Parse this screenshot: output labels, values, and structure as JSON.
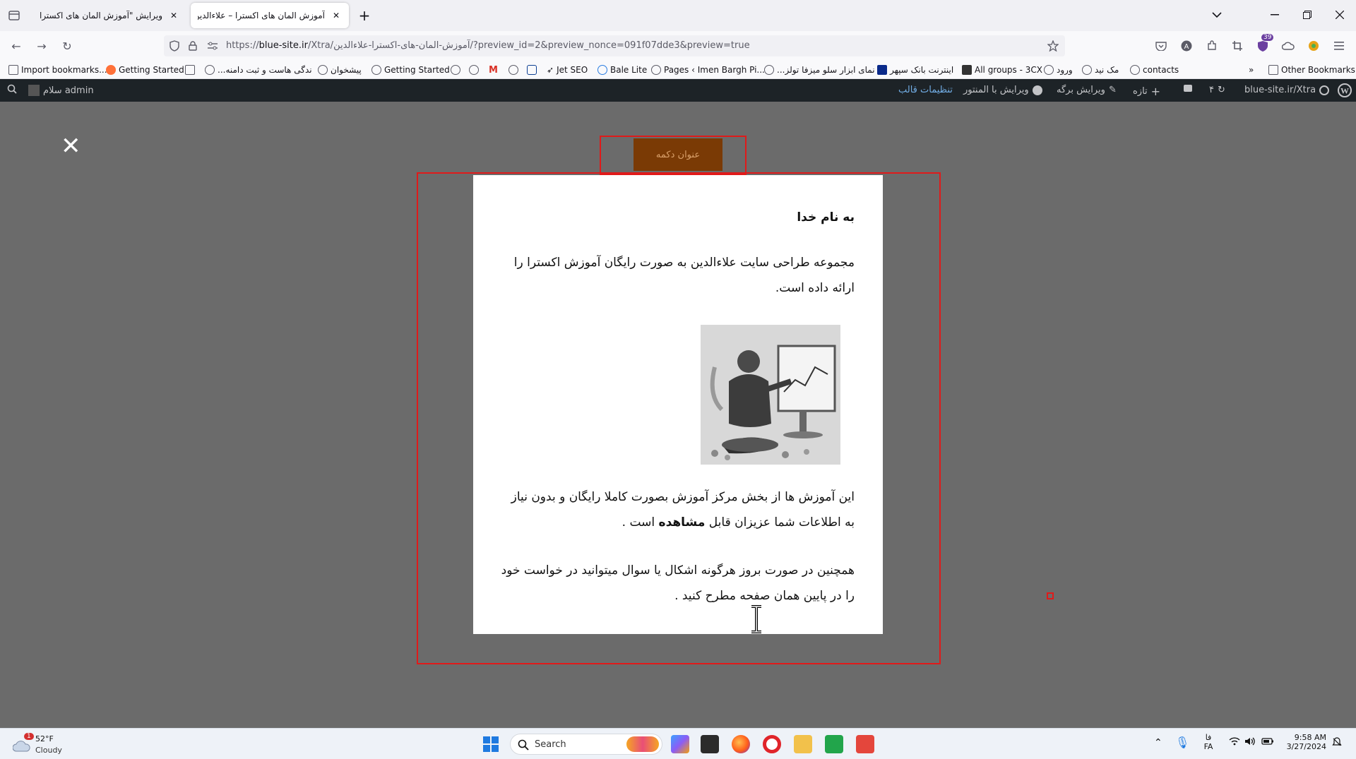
{
  "browser": {
    "tabs": [
      {
        "title": "ویرایش \"آموزش المان های اکسترا – علا",
        "active": false
      },
      {
        "title": "آموزش المان های اکسترا – علاءالدین",
        "active": true
      }
    ],
    "url_prefix": "https://",
    "url_domain": "blue-site.ir",
    "url_rest": "/Xtra/آموزش-المان-های-اکسترا-علاءالدین/?preview_id=2&preview_nonce=091f07dde3&preview=true",
    "notification_badge": "39",
    "bookmarks": [
      "Import bookmarks...",
      "Getting Started",
      "...ندگی هاست و ثبت دامنه",
      "پیشخوان",
      "Getting Started",
      "Jet SEO",
      "Bale Lite",
      "Pages ‹ Imen Bargh Pi...",
      "...نمای ابزار سلو میزفا تولز",
      "اینترنت بانک سپهر",
      "All groups - 3CX",
      "ورود",
      "مک نید",
      "contacts"
    ],
    "other_bookmarks": "Other Bookmarks"
  },
  "wp_admin_bar": {
    "site": "blue-site.ir/Xtra",
    "updates": "۴",
    "new": "تازه",
    "edit_page": "ویرایش برگه",
    "edit_elementor": "ویرایش با المنتور",
    "theme_settings": "تنظیمات قالب",
    "greeting": "سلام admin"
  },
  "popup": {
    "button_label": "عنوان دکمه",
    "heading": "به نام خدا",
    "para1": "مجموعه طراحی سایت علاءالدین به صورت رایگان آموزش اکسترا را ارائه داده است.",
    "para2_before": "این آموزش ها از بخش مرکز آموزش بصورت کاملا رایگان و بدون نیاز به اطلاعات شما عزیزان قابل ",
    "para2_bold": "مشاهده",
    "para2_after": " است .",
    "para3": "همچنین در صورت بروز هرگونه اشکال یا سوال میتوانید در خواست خود را در پایین همان صفحه مطرح کنید ."
  },
  "taskbar": {
    "weather_temp": "52°F",
    "weather_desc": "Cloudy",
    "weather_badge": "1",
    "search_placeholder": "Search",
    "lang_top": "فا",
    "lang_bottom": "FA",
    "time": "9:58 AM",
    "date": "3/27/2024"
  }
}
